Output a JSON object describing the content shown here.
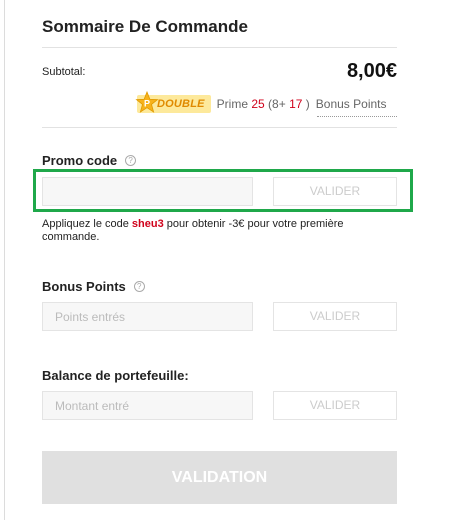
{
  "summary": {
    "title": "Sommaire De Commande",
    "subtotal_label": "Subtotal:",
    "subtotal_value": "8,00€"
  },
  "points": {
    "badge_text": "DOUBLE",
    "prime_label": "Prime",
    "prime_value": "25",
    "bonus_open": "(8+",
    "bonus_value": "17",
    "bonus_close": ")",
    "bonus_link": "Bonus Points"
  },
  "promo": {
    "label": "Promo code",
    "input_value": "",
    "input_placeholder": "",
    "button_label": "VALIDER",
    "note_before": "Appliquez le code",
    "note_code": "sheu3",
    "note_after": "pour obtenir -3€ pour votre première commande."
  },
  "bonus_points": {
    "label": "Bonus Points",
    "input_placeholder": "Points entrés",
    "button_label": "VALIDER"
  },
  "wallet": {
    "label": "Balance de portefeuille:",
    "input_placeholder": "Montant entré",
    "button_label": "VALIDER"
  },
  "validation_button": "VALIDATION",
  "colors": {
    "highlight": "#1fa84a",
    "accent_red": "#d0021b",
    "badge_bg": "#fde99b",
    "badge_text": "#e08a00"
  },
  "icons": {
    "badge": "star-p-icon",
    "help": "question-circle-icon"
  }
}
